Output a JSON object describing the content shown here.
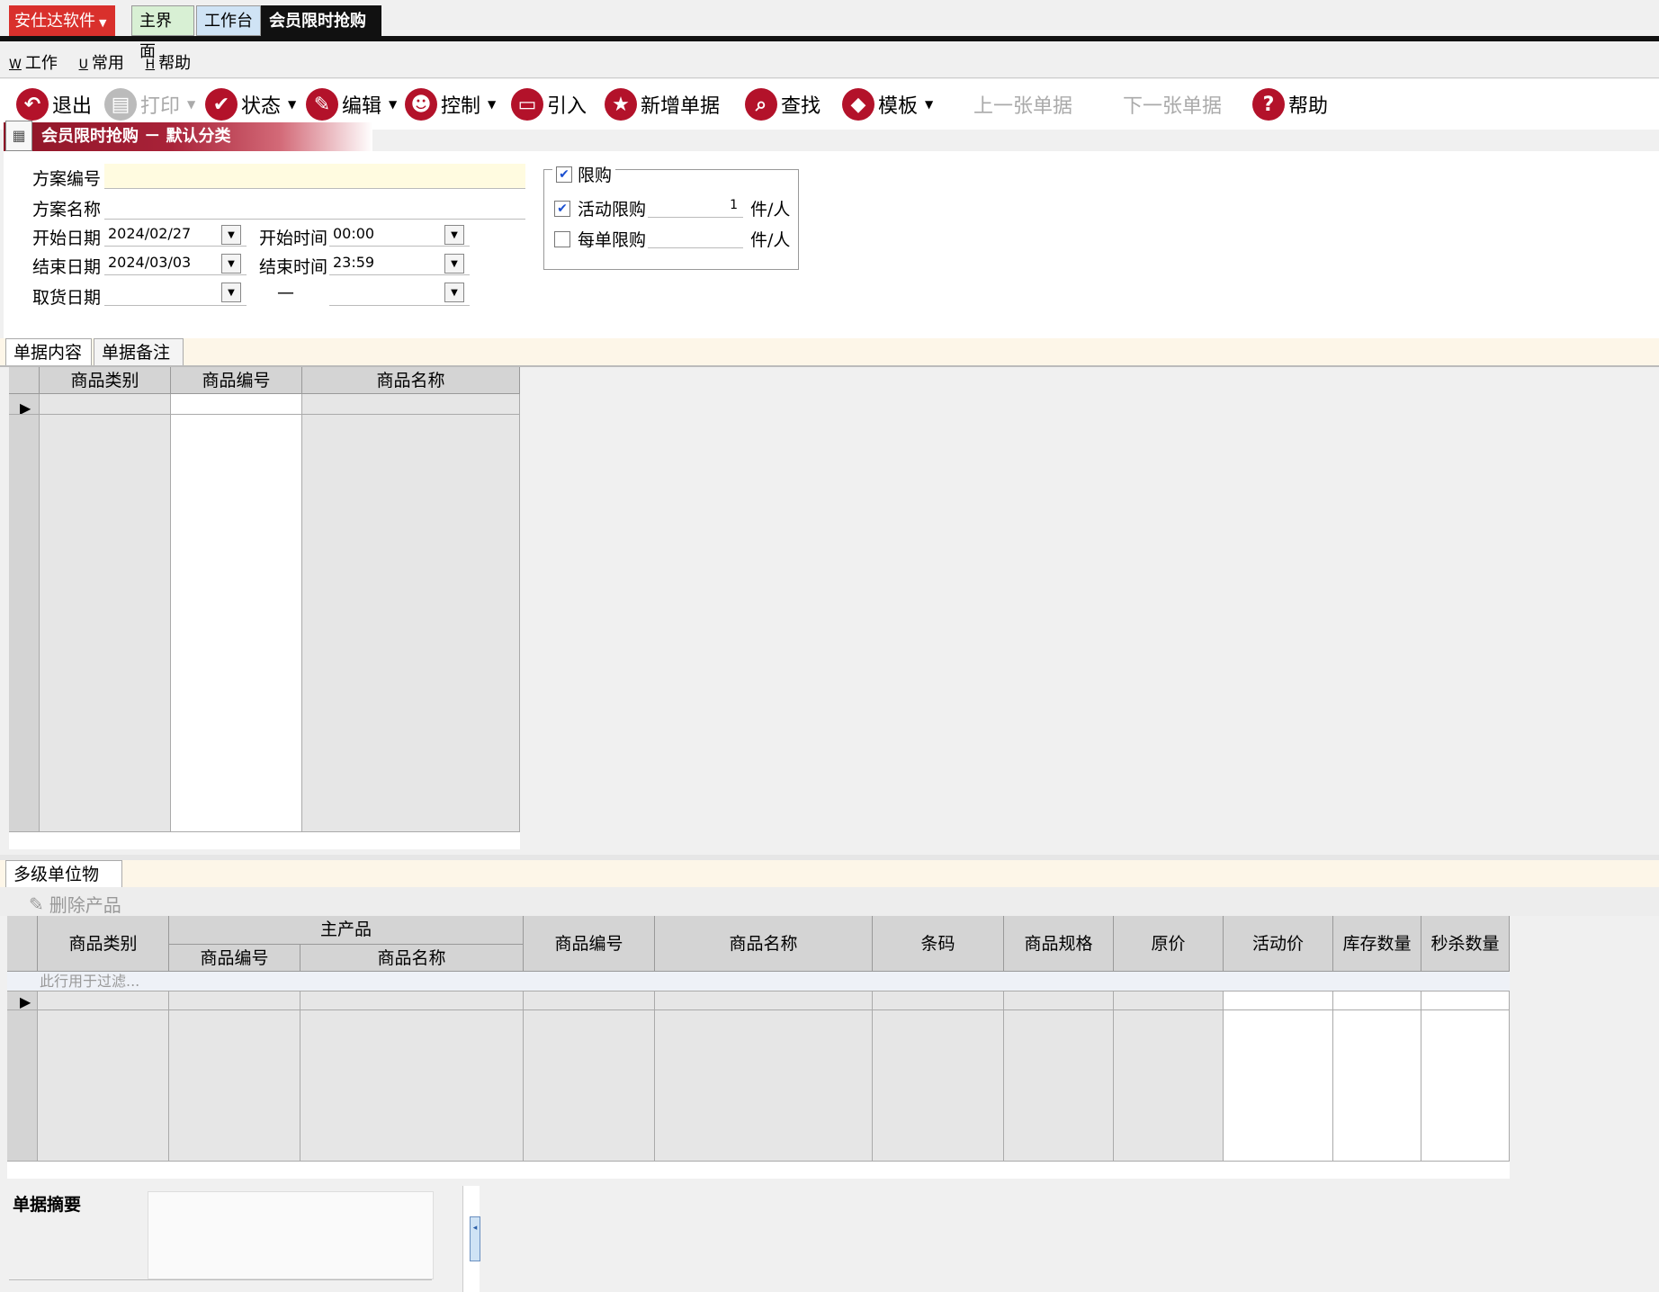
{
  "app": {
    "brand": "安仕达软件",
    "tabs": [
      "主界面",
      "工作台",
      "会员限时抢购"
    ]
  },
  "menu": [
    {
      "key": "W",
      "label": "工作"
    },
    {
      "key": "U",
      "label": "常用"
    },
    {
      "key": "H",
      "label": "帮助"
    }
  ],
  "toolbar": {
    "exit": "退出",
    "print": "打印",
    "status": "状态",
    "edit": "编辑",
    "control": "控制",
    "import": "引入",
    "new_doc": "新增单据",
    "find": "查找",
    "template": "模板",
    "prev_doc": "上一张单据",
    "next_doc": "下一张单据",
    "help": "帮助"
  },
  "title_strip": "会员限时抢购 － 默认分类",
  "form": {
    "plan_no_label": "方案编号",
    "plan_no": "",
    "plan_name_label": "方案名称",
    "plan_name": "",
    "start_date_label": "开始日期",
    "start_date": "2024/02/27",
    "start_time_label": "开始时间",
    "start_time": "00:00",
    "end_date_label": "结束日期",
    "end_date": "2024/03/03",
    "end_time_label": "结束时间",
    "end_time": "23:59",
    "pickup_date_label": "取货日期",
    "pickup_dash": "—"
  },
  "limit_group": {
    "title": "限购",
    "checked": true,
    "activity_limit_label": "活动限购",
    "activity_limit_checked": true,
    "activity_limit_value": "1",
    "activity_unit": "件/人",
    "order_limit_label": "每单限购",
    "order_limit_checked": false,
    "order_unit": "件/人"
  },
  "section1": {
    "tabs": [
      "单据内容",
      "单据备注"
    ],
    "columns": [
      "商品类别",
      "商品编号",
      "商品名称"
    ]
  },
  "section2": {
    "tab": "多级单位物料",
    "delete_btn": "删除产品",
    "group_header": "主产品",
    "columns": [
      "商品类别",
      "商品编号",
      "商品名称",
      "商品编号",
      "商品名称",
      "条码",
      "商品规格",
      "原价",
      "活动价",
      "库存数量",
      "秒杀数量"
    ],
    "filter_placeholder": "此行用于过滤..."
  },
  "summary_label": "单据摘要"
}
